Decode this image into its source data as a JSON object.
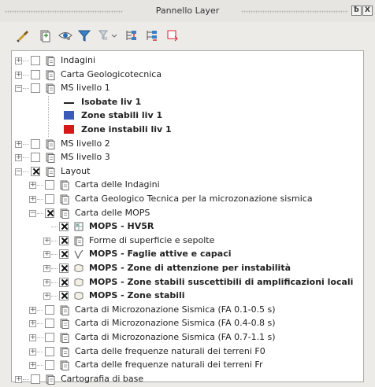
{
  "panel": {
    "title": "Pannello Layer",
    "float_button": "ƀ",
    "close_button": "X"
  },
  "toolbar": {
    "icons": [
      "paint-brush-icon",
      "add-group-icon",
      "eye-icon",
      "filter-icon",
      "filter-expression-icon",
      "expand-all-icon",
      "collapse-all-icon",
      "remove-layer-icon"
    ]
  },
  "colors": {
    "zone_stabili": "#3a5bb8",
    "zone_instabili": "#d61a1a",
    "isobate": "#222222"
  },
  "tree": [
    {
      "label": "Indagini",
      "checked": false,
      "expander": "+",
      "kind": "group",
      "bold": false
    },
    {
      "label": "Carta Geologicotecnica",
      "checked": false,
      "expander": "+",
      "kind": "group",
      "bold": false
    },
    {
      "label": "MS livello 1",
      "checked": false,
      "expander": "−",
      "kind": "group",
      "bold": false
    },
    {
      "label": "Isobate liv 1",
      "kind": "legend-line",
      "bold": true
    },
    {
      "label": "Zone stabili liv 1",
      "kind": "legend-blue",
      "bold": true
    },
    {
      "label": "Zone instabili liv 1",
      "kind": "legend-red",
      "bold": true
    },
    {
      "label": "MS livello 2",
      "checked": false,
      "expander": "+",
      "kind": "group",
      "bold": false
    },
    {
      "label": "MS livello 3",
      "checked": false,
      "expander": "+",
      "kind": "group",
      "bold": false
    },
    {
      "label": "Layout",
      "checked": true,
      "expander": "−",
      "kind": "group",
      "bold": false
    },
    {
      "label": "Carta delle Indagini",
      "checked": false,
      "expander": "+",
      "kind": "group",
      "bold": false
    },
    {
      "label": "Carta Geologico Tecnica per la microzonazione sismica",
      "checked": false,
      "expander": "+",
      "kind": "group",
      "bold": false
    },
    {
      "label": "Carta delle MOPS",
      "checked": true,
      "expander": "−",
      "kind": "group",
      "bold": false
    },
    {
      "label": "MOPS - HV5R",
      "checked": true,
      "expander": "",
      "kind": "raster",
      "bold": true
    },
    {
      "label": "Forme di superficie e sepolte",
      "checked": true,
      "expander": "+",
      "kind": "group",
      "bold": false
    },
    {
      "label": "MOPS - Faglie attive e capaci",
      "checked": true,
      "expander": "+",
      "kind": "line",
      "bold": true
    },
    {
      "label": "MOPS - Zone di attenzione per instabilità",
      "checked": true,
      "expander": "+",
      "kind": "polygon",
      "bold": true
    },
    {
      "label": "MOPS - Zone stabili suscettibili di amplificazioni locali",
      "checked": true,
      "expander": "+",
      "kind": "polygon",
      "bold": true
    },
    {
      "label": "MOPS - Zone stabili",
      "checked": true,
      "expander": "+",
      "kind": "polygon",
      "bold": true
    },
    {
      "label": "Carta di Microzonazione Sismica (FA 0.1-0.5 s)",
      "checked": false,
      "expander": "+",
      "kind": "group",
      "bold": false
    },
    {
      "label": "Carta di Microzonazione Sismica (FA 0.4-0.8 s)",
      "checked": false,
      "expander": "+",
      "kind": "group",
      "bold": false
    },
    {
      "label": "Carta di Microzonazione Sismica (FA 0.7-1.1 s)",
      "checked": false,
      "expander": "+",
      "kind": "group",
      "bold": false
    },
    {
      "label": "Carta delle frequenze naturali dei terreni F0",
      "checked": false,
      "expander": "+",
      "kind": "group",
      "bold": false
    },
    {
      "label": "Carta delle frequenze naturali dei terreni Fr",
      "checked": false,
      "expander": "+",
      "kind": "group",
      "bold": false
    },
    {
      "label": "Cartografia di base",
      "checked": false,
      "expander": "+",
      "kind": "group",
      "bold": false
    }
  ]
}
